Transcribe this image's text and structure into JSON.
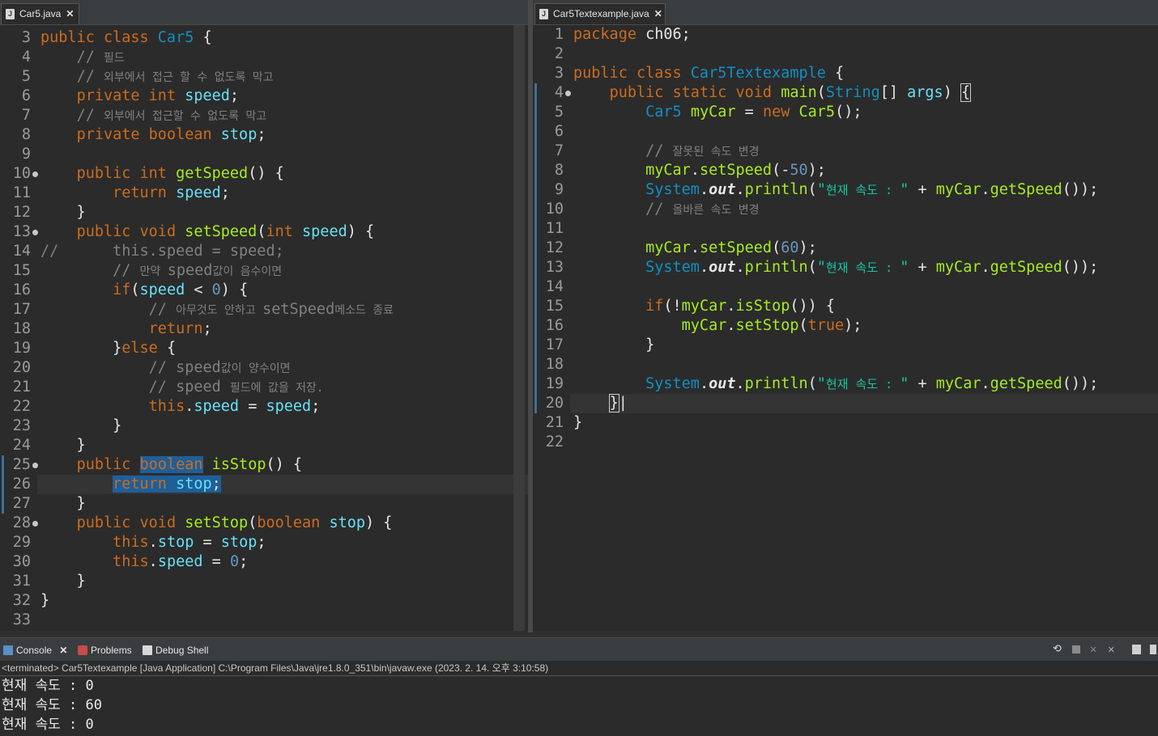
{
  "left_editor": {
    "tab": {
      "label": "Car5.java"
    },
    "lines": [
      {
        "n": "3",
        "html": "<span class='kw'>public class </span><span class='ty'>Car5</span> {"
      },
      {
        "n": "4",
        "html": "    <span class='cmk'>// </span><span class='cm'>필드</span>"
      },
      {
        "n": "5",
        "html": "    <span class='cmk'>// </span><span class='cm'>외부에서 접근 할 수 없도록 막고</span>"
      },
      {
        "n": "6",
        "html": "    <span class='kw'>private int </span><span class='var'>speed</span>;"
      },
      {
        "n": "7",
        "html": "    <span class='cmk'>// </span><span class='cm'>외부에서 접근할 수 없도록 막고</span>"
      },
      {
        "n": "8",
        "html": "    <span class='kw'>private boolean </span><span class='var'>stop</span>;"
      },
      {
        "n": "9",
        "html": ""
      },
      {
        "n": "10",
        "dot": true,
        "html": "    <span class='kw'>public int </span><span class='fn'>getSpeed</span>() {"
      },
      {
        "n": "11",
        "html": "        <span class='kw'>return </span><span class='var'>speed</span>;"
      },
      {
        "n": "12",
        "html": "    }"
      },
      {
        "n": "13",
        "dot": true,
        "html": "    <span class='kw'>public void </span><span class='fn'>setSpeed</span>(<span class='kw'>int </span><span class='var'>speed</span>) {"
      },
      {
        "n": "14",
        "html": "<span class='cmk'>//      this.speed = speed;</span>"
      },
      {
        "n": "15",
        "html": "        <span class='cmk'>// </span><span class='cm'>만약 </span><span class='cmk'>speed</span><span class='cm'>값이 음수이면</span>"
      },
      {
        "n": "16",
        "html": "        <span class='kw'>if</span>(<span class='var'>speed</span> &lt; <span class='num'>0</span>) {"
      },
      {
        "n": "17",
        "html": "            <span class='cmk'>// </span><span class='cm'>아무것도 안하고 </span><span class='cmk'>setSpeed</span><span class='cm'>메소드 종료</span>"
      },
      {
        "n": "18",
        "html": "            <span class='kw'>return</span>;"
      },
      {
        "n": "19",
        "html": "        }<span class='kw'>else</span> {"
      },
      {
        "n": "20",
        "html": "            <span class='cmk'>// speed</span><span class='cm'>값이 양수이면</span>"
      },
      {
        "n": "21",
        "html": "            <span class='cmk'>// speed </span><span class='cm'>필드에 값을 저장.</span>"
      },
      {
        "n": "22",
        "html": "            <span class='kw'>this</span>.<span class='var'>speed</span> = <span class='var'>speed</span>;"
      },
      {
        "n": "23",
        "html": "        }"
      },
      {
        "n": "24",
        "html": "    }"
      },
      {
        "n": "25",
        "dot": true,
        "bar": true,
        "html": "    <span class='kw'>public </span><span class='kw sel'>boolean</span> <span class='fn'>isStop</span>() {"
      },
      {
        "n": "26",
        "bar": true,
        "current": true,
        "html": "        <span class='sel'><span class='kw'>return </span><span class='var'>stop</span>;</span>"
      },
      {
        "n": "27",
        "bar": true,
        "html": "    }"
      },
      {
        "n": "28",
        "dot": true,
        "html": "    <span class='kw'>public void </span><span class='fn'>setStop</span>(<span class='kw'>boolean </span><span class='var'>stop</span>) {"
      },
      {
        "n": "29",
        "html": "        <span class='kw'>this</span>.<span class='var'>stop</span> = <span class='var'>stop</span>;"
      },
      {
        "n": "30",
        "html": "        <span class='kw'>this</span>.<span class='var'>speed</span> = <span class='num'>0</span>;"
      },
      {
        "n": "31",
        "html": "    }"
      },
      {
        "n": "32",
        "html": "}"
      },
      {
        "n": "33",
        "html": ""
      }
    ]
  },
  "right_editor": {
    "tab": {
      "label": "Car5Textexample.java"
    },
    "lines": [
      {
        "n": "1",
        "html": "<span class='kw'>package </span>ch06;"
      },
      {
        "n": "2",
        "html": ""
      },
      {
        "n": "3",
        "html": "<span class='kw'>public class </span><span class='ty'>Car5Textexample</span> {"
      },
      {
        "n": "4",
        "dot": true,
        "bar": true,
        "html": "    <span class='kw'>public static void </span><span class='fn'>main</span>(<span class='ty'>String</span>[] <span class='var'>args</span>) <span style='outline:1px solid #ccc'>{</span>"
      },
      {
        "n": "5",
        "bar": true,
        "html": "        <span class='ty'>Car5</span> <span class='fn'>myCar</span> = <span class='kw'>new </span><span class='fn'>Car5</span>();"
      },
      {
        "n": "6",
        "bar": true,
        "html": ""
      },
      {
        "n": "7",
        "bar": true,
        "html": "        <span class='cmk'>// </span><span class='cm'>잘못된 속도 변경</span>"
      },
      {
        "n": "8",
        "bar": true,
        "html": "        <span class='fn'>myCar</span>.<span class='fn'>setSpeed</span>(-<span class='num'>50</span>);"
      },
      {
        "n": "9",
        "bar": true,
        "html": "        <span class='ty'>System</span>.<span class='it'>out</span>.<span class='fn'>println</span>(<span class='st'>\"<span class='kr'>현재 속도 : </span>\"</span> + <span class='fn'>myCar</span>.<span class='fn'>getSpeed</span>());"
      },
      {
        "n": "10",
        "bar": true,
        "html": "        <span class='cmk'>// </span><span class='cm'>올바른 속도 변경</span>"
      },
      {
        "n": "11",
        "bar": true,
        "html": ""
      },
      {
        "n": "12",
        "bar": true,
        "html": "        <span class='fn'>myCar</span>.<span class='fn'>setSpeed</span>(<span class='num'>60</span>);"
      },
      {
        "n": "13",
        "bar": true,
        "html": "        <span class='ty'>System</span>.<span class='it'>out</span>.<span class='fn'>println</span>(<span class='st'>\"<span class='kr'>현재 속도 : </span>\"</span> + <span class='fn'>myCar</span>.<span class='fn'>getSpeed</span>());"
      },
      {
        "n": "14",
        "bar": true,
        "html": ""
      },
      {
        "n": "15",
        "bar": true,
        "html": "        <span class='kw'>if</span>(!<span class='fn'>myCar</span>.<span class='fn'>isStop</span>()) {"
      },
      {
        "n": "16",
        "bar": true,
        "html": "            <span class='fn'>myCar</span>.<span class='fn'>setStop</span>(<span class='kw'>true</span>);"
      },
      {
        "n": "17",
        "bar": true,
        "html": "        }"
      },
      {
        "n": "18",
        "bar": true,
        "html": ""
      },
      {
        "n": "19",
        "bar": true,
        "html": "        <span class='ty'>System</span>.<span class='it'>out</span>.<span class='fn'>println</span>(<span class='st'>\"<span class='kr'>현재 속도 : </span>\"</span> + <span class='fn'>myCar</span>.<span class='fn'>getSpeed</span>());"
      },
      {
        "n": "20",
        "bar": true,
        "current": true,
        "html": "    <span style='outline:1px solid #ccc'>}</span>|"
      },
      {
        "n": "21",
        "html": "}"
      },
      {
        "n": "22",
        "html": ""
      }
    ]
  },
  "console": {
    "tabs": [
      {
        "label": "Console",
        "icon": "console-icon",
        "active": true
      },
      {
        "label": "Problems",
        "icon": "problems-icon"
      },
      {
        "label": "Debug Shell",
        "icon": "debug-shell-icon"
      }
    ],
    "status": "<terminated> Car5Textexample [Java Application] C:\\Program Files\\Java\\jre1.8.0_351\\bin\\javaw.exe (2023. 2. 14. 오후 3:10:58)",
    "output": [
      "현재 속도 : 0",
      "현재 속도 : 60",
      "현재 속도 : 0"
    ],
    "close": "✕"
  },
  "colors": {
    "keyword": "#cc6c1d",
    "type": "#1290c3",
    "method": "#a7ec21",
    "field": "#66e1f8",
    "comment": "#808080",
    "string": "#17c6a3",
    "number": "#6897bb"
  }
}
